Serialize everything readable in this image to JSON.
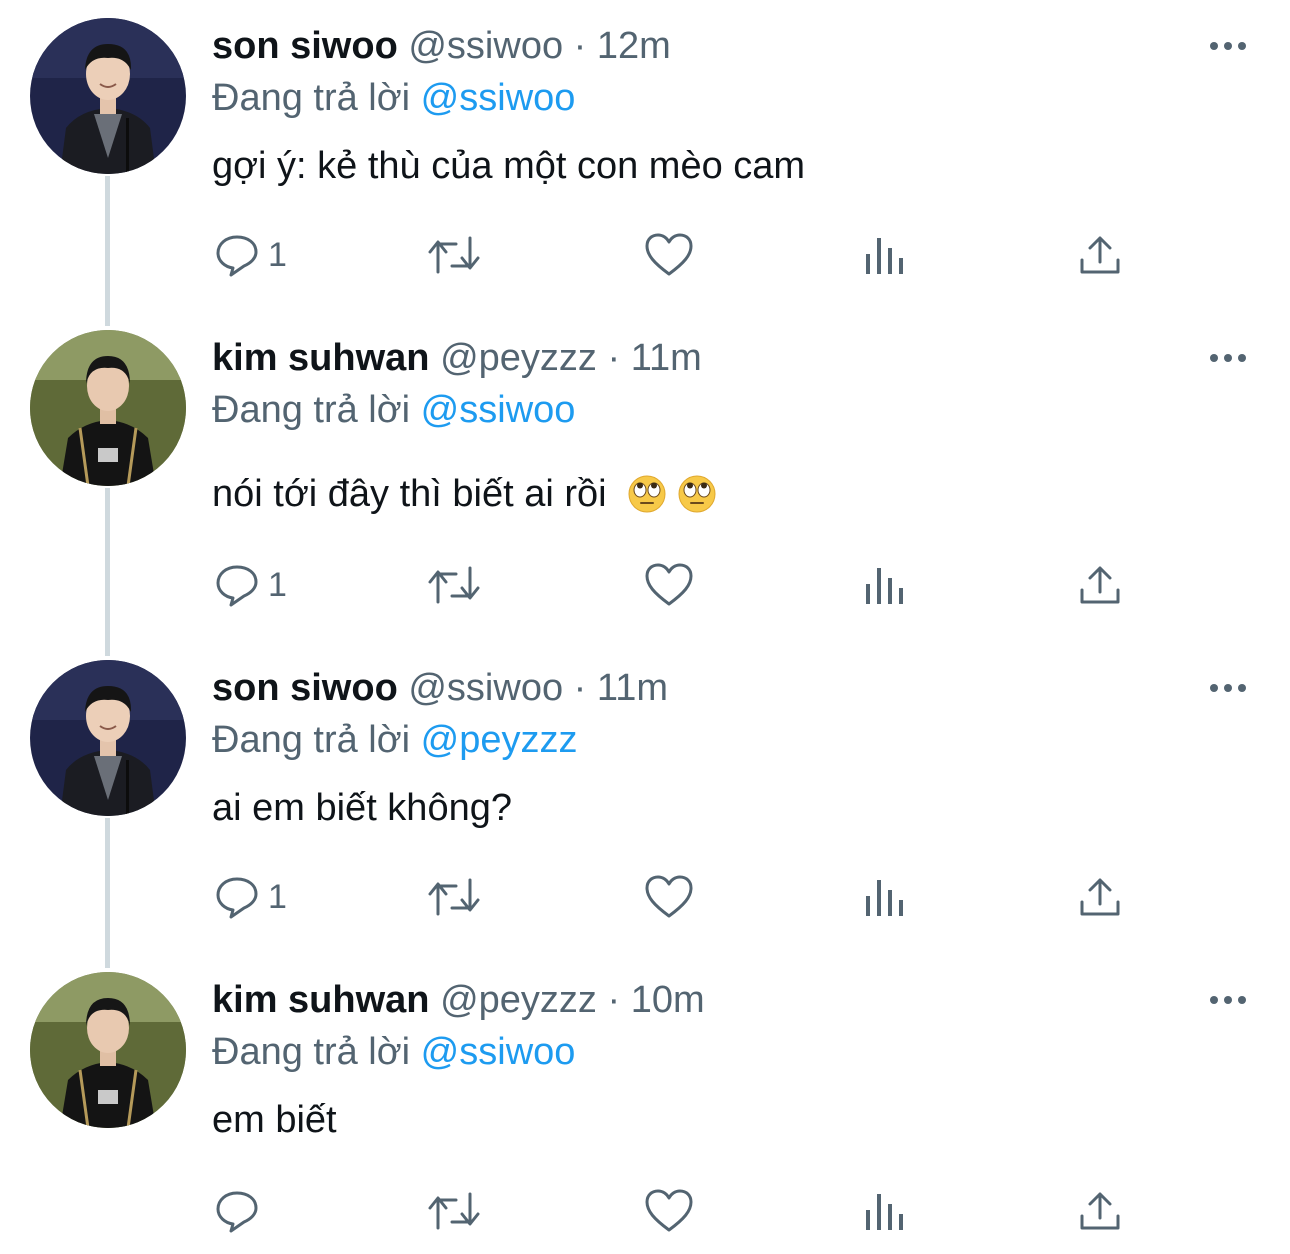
{
  "colors": {
    "text": "#0f1419",
    "secondary": "#536471",
    "mention": "#1d9bf0",
    "thread_line": "#cfd9de"
  },
  "tweets": [
    {
      "name": "son siwoo",
      "handle": "@ssiwoo",
      "separator": "·",
      "time": "12m",
      "reply_prefix": "Đang trả lời",
      "reply_to": "@ssiwoo",
      "text": "gợi ý: kẻ thù của một con mèo cam",
      "emojis": [],
      "reply_count": "1",
      "avatar": "person-in-suit-avatar"
    },
    {
      "name": "kim suhwan",
      "handle": "@peyzzz",
      "separator": "·",
      "time": "11m",
      "reply_prefix": "Đang trả lời",
      "reply_to": "@ssiwoo",
      "text": "nói tới đây thì biết ai rồi",
      "emojis": [
        "eye-roll-emoji",
        "eye-roll-emoji"
      ],
      "reply_count": "1",
      "avatar": "person-in-jersey-avatar"
    },
    {
      "name": "son siwoo",
      "handle": "@ssiwoo",
      "separator": "·",
      "time": "11m",
      "reply_prefix": "Đang trả lời",
      "reply_to": "@peyzzz",
      "text": "ai em biết không?",
      "emojis": [],
      "reply_count": "1",
      "avatar": "person-in-suit-avatar"
    },
    {
      "name": "kim suhwan",
      "handle": "@peyzzz",
      "separator": "·",
      "time": "10m",
      "reply_prefix": "Đang trả lời",
      "reply_to": "@ssiwoo",
      "text": "em biết",
      "emojis": [],
      "reply_count": "",
      "avatar": "person-in-jersey-avatar"
    }
  ],
  "icons": {
    "more": "more-horizontal-icon",
    "reply": "reply-icon",
    "retweet": "retweet-icon",
    "like": "like-icon",
    "views": "views-icon",
    "share": "share-icon"
  }
}
